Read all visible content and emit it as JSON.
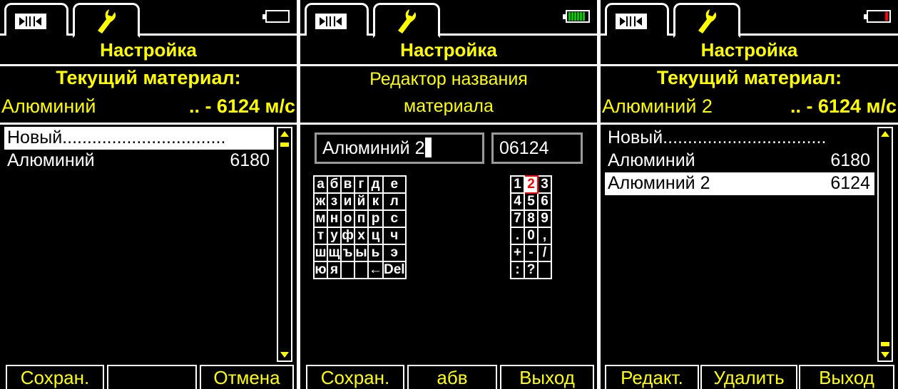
{
  "screens": [
    {
      "title": "Настройка",
      "current_label": "Текущий материал:",
      "current_name": "Алюминий",
      "current_velocity": ".. - 6124 м/с",
      "items": [
        {
          "name": "Новый.................................",
          "value": ""
        },
        {
          "name": "Алюминий",
          "value": "6180"
        }
      ],
      "softkeys": {
        "left": "Сохран.",
        "middle": "",
        "right": "Отмена"
      }
    },
    {
      "title": "Настройка",
      "editor_title_line1": "Редактор названия",
      "editor_title_line2": "материала",
      "name_value": "Алюминий 2",
      "velocity_value": "06124",
      "letters": [
        [
          "а",
          "б",
          "в",
          "г",
          "д",
          "е"
        ],
        [
          "ж",
          "з",
          "и",
          "й",
          "к",
          "л"
        ],
        [
          "м",
          "н",
          "о",
          "п",
          "р",
          "с"
        ],
        [
          "т",
          "у",
          "ф",
          "х",
          "ц",
          "ч"
        ],
        [
          "ш",
          "щ",
          "ъ",
          "ы",
          "ь",
          "э"
        ],
        [
          "ю",
          "я",
          "",
          "",
          "←",
          "Del"
        ]
      ],
      "digits": [
        [
          "1",
          "2",
          "3"
        ],
        [
          "4",
          "5",
          "6"
        ],
        [
          "7",
          "8",
          "9"
        ],
        [
          ".",
          "0",
          ","
        ],
        [
          "+",
          "-",
          "/"
        ],
        [
          ":",
          "?",
          ""
        ]
      ],
      "selected_key": "2",
      "softkeys": {
        "left": "Сохран.",
        "middle": "абв",
        "right": "Выход"
      }
    },
    {
      "title": "Настройка",
      "current_label": "Текущий материал:",
      "current_name": "Алюминий 2",
      "current_velocity": ".. - 6124 м/с",
      "items": [
        {
          "name": "Новый.................................",
          "value": ""
        },
        {
          "name": "Алюминий",
          "value": "6180"
        },
        {
          "name": "Алюминий 2",
          "value": "6124"
        }
      ],
      "softkeys": {
        "left": "Редакт.",
        "middle": "Удалить",
        "right": "Выход"
      }
    }
  ],
  "icons": {
    "tab1": "play-pause-icon",
    "tab2": "wrench-icon",
    "battery": "battery-icon"
  },
  "colors": {
    "accent": "#ffff00",
    "background": "#000000",
    "selection": "#ffffff",
    "battery_full": "#00cc00",
    "battery_low": "#ff0000",
    "key_highlight": "#ff0000"
  }
}
